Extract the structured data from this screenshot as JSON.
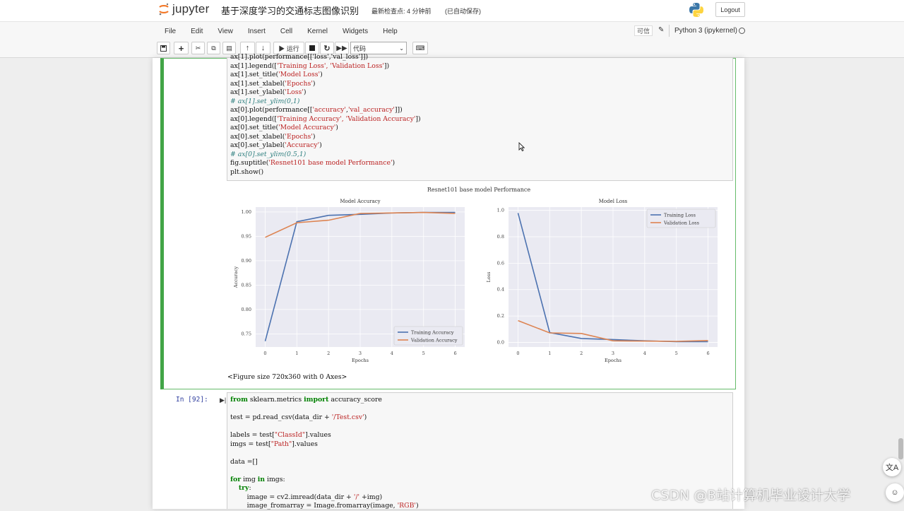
{
  "header": {
    "logo_text": "jupyter",
    "notebook_title": "基于深度学习的交通标志图像识别",
    "checkpoint": "最新检查点: 4 分钟前",
    "autosave": "(已自动保存)",
    "logout": "Logout"
  },
  "menu": [
    "File",
    "Edit",
    "View",
    "Insert",
    "Cell",
    "Kernel",
    "Widgets",
    "Help"
  ],
  "kernel": {
    "trusted": "可信",
    "name": "Python 3 (ipykernel)"
  },
  "toolbar": {
    "run_label": "▶ 运行",
    "cell_type": "代码"
  },
  "cell1": {
    "code_lines": [
      "ax[1].plot(performance[['loss','val_loss']])",
      "ax[1].legend(['Training Loss', 'Validation Loss'])",
      "ax[1].set_title('Model Loss')",
      "ax[1].set_xlabel('Epochs')",
      "ax[1].set_ylabel('Loss')",
      "# ax[1].set_ylim(0,1)",
      "ax[0].plot(performance[['accuracy','val_accuracy']])",
      "ax[0].legend(['Training Accuracy', 'Validation Accuracy'])",
      "ax[0].set_title('Model Accuracy')",
      "ax[0].set_xlabel('Epochs')",
      "ax[0].set_ylabel('Accuracy')",
      "# ax[0].set_ylim(0.5,1)",
      "fig.suptitle('Resnet101 base model Performance')",
      "plt.show()"
    ],
    "figure_output": "<Figure size 720x360 with 0 Axes>"
  },
  "chart_data": [
    {
      "type": "line",
      "suptitle": "Resnet101 base model Performance",
      "title": "Model Accuracy",
      "xlabel": "Epochs",
      "ylabel": "Accuracy",
      "x": [
        0,
        1,
        2,
        3,
        4,
        5,
        6
      ],
      "series": [
        {
          "name": "Training Accuracy",
          "color": "#4c72b0",
          "values": [
            0.735,
            0.98,
            0.993,
            0.995,
            0.998,
            0.999,
            0.999
          ]
        },
        {
          "name": "Validation Accuracy",
          "color": "#dd8452",
          "values": [
            0.948,
            0.978,
            0.983,
            0.997,
            0.998,
            0.999,
            0.997
          ]
        }
      ],
      "xticks": [
        "0",
        "1",
        "2",
        "3",
        "4",
        "5",
        "6"
      ],
      "yticks": [
        "0.75",
        "0.80",
        "0.85",
        "0.90",
        "0.95",
        "1.00"
      ],
      "xlim": [
        -0.3,
        6.3
      ],
      "ylim": [
        0.723,
        1.01
      ],
      "legend_loc": "lower-right",
      "grid": true
    },
    {
      "type": "line",
      "title": "Model Loss",
      "xlabel": "Epochs",
      "ylabel": "Loss",
      "x": [
        0,
        1,
        2,
        3,
        4,
        5,
        6
      ],
      "series": [
        {
          "name": "Training Loss",
          "color": "#4c72b0",
          "values": [
            0.98,
            0.075,
            0.03,
            0.022,
            0.012,
            0.005,
            0.005
          ]
        },
        {
          "name": "Validation Loss",
          "color": "#dd8452",
          "values": [
            0.165,
            0.072,
            0.068,
            0.012,
            0.01,
            0.008,
            0.014
          ]
        }
      ],
      "xticks": [
        "0",
        "1",
        "2",
        "3",
        "4",
        "5",
        "6"
      ],
      "yticks": [
        "0.0",
        "0.2",
        "0.4",
        "0.6",
        "0.8",
        "1.0"
      ],
      "xlim": [
        -0.3,
        6.3
      ],
      "ylim": [
        -0.035,
        1.025
      ],
      "legend_loc": "upper-right",
      "grid": true
    }
  ],
  "cell2": {
    "prompt": "In [92]:",
    "code_lines": [
      "from sklearn.metrics import accuracy_score",
      "",
      "test = pd.read_csv(data_dir + '/Test.csv')",
      "",
      "labels = test[\"ClassId\"].values",
      "imgs = test[\"Path\"].values",
      "",
      "data =[]",
      "",
      "for img in imgs:",
      "    try:",
      "        image = cv2.imread(data_dir + '/' +img)",
      "        image_fromarray = Image.fromarray(image, 'RGB')"
    ]
  },
  "watermark": "CSDN @B站计算机毕业设计大学"
}
